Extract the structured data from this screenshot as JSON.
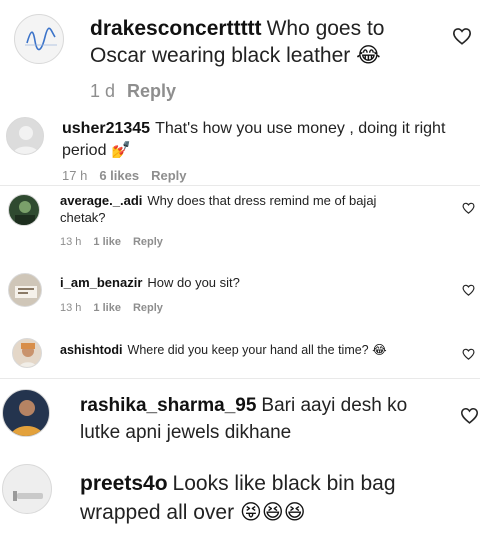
{
  "comments": [
    {
      "username": "drakesconcerttttt",
      "text": "Who goes to Oscar wearing black leather",
      "emoji": "😂",
      "time": "1 d",
      "likes": "",
      "reply": "Reply"
    },
    {
      "username": "usher21345",
      "text": "That's how you use money , doing it right period",
      "emoji": "💅",
      "time": "17 h",
      "likes": "6 likes",
      "reply": "Reply"
    },
    {
      "username": "average._.adi",
      "text": "Why does that dress remind me of bajaj chetak?",
      "emoji": "",
      "time": "13 h",
      "likes": "1 like",
      "reply": "Reply"
    },
    {
      "username": "i_am_benazir",
      "text": "How do you sit?",
      "emoji": "",
      "time": "13 h",
      "likes": "1 like",
      "reply": "Reply"
    },
    {
      "username": "ashishtodi",
      "text": "Where did you keep your hand all the time?",
      "emoji": "😂",
      "time": "",
      "likes": "",
      "reply": ""
    },
    {
      "username": "rashika_sharma_95",
      "text": "Bari aayi desh ko lutke apni jewels dikhane",
      "emoji": "",
      "time": "",
      "likes": "",
      "reply": ""
    },
    {
      "username": "preets4o",
      "text": "Looks like black bin bag wrapped all over",
      "emoji": "😝😆😆",
      "time": "",
      "likes": "",
      "reply": ""
    }
  ]
}
